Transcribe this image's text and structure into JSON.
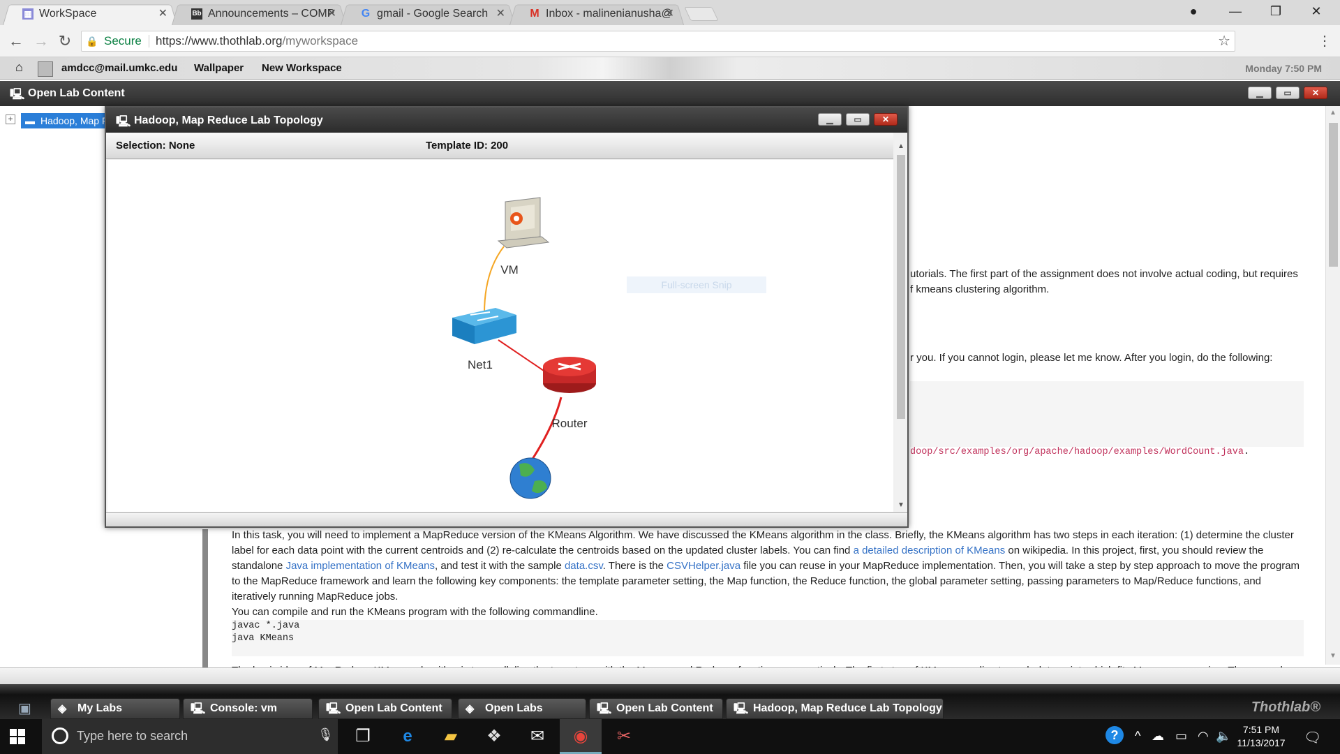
{
  "browser": {
    "tabs": [
      {
        "label": "WorkSpace",
        "icon": "workspace-icon",
        "active": true
      },
      {
        "label": "Announcements – COMP",
        "icon": "bb-icon"
      },
      {
        "label": "gmail - Google Search",
        "icon": "google-icon"
      },
      {
        "label": "Inbox - malinenianusha@",
        "icon": "gmail-icon"
      }
    ],
    "secure_label": "Secure",
    "url_host": "https://www.thothlab.org",
    "url_path": "/myworkspace"
  },
  "labbar": {
    "user": "amdcc@mail.umkc.edu",
    "wallpaper": "Wallpaper",
    "new_workspace": "New Workspace",
    "clock": "Monday 7:50 PM"
  },
  "olc": {
    "title": "Open Lab Content",
    "tree_node": "Hadoop, Map R"
  },
  "doc": {
    "line1": "utorials. The first part of the assignment does not involve actual coding, but requires",
    "line2": "f kmeans clustering algorithm.",
    "line3": "r you. If you cannot login, please let me know. After you login, do the following:",
    "code_path": "doop/src/examples/org/apache/hadoop/examples/WordCount.java",
    "code_path_end": ".",
    "para_a": "In this task, you will need to implement a MapReduce version of the KMeans Algorithm. We have discussed the KMeans algorithm in the class. Briefly, the KMeans algorithm has two steps in each iteration: (1) determine the cluster",
    "para_b": "label for each data point with the current centroids and (2) re-calculate the centroids based on the updated cluster labels. You can find ",
    "link_desc": "a detailed description of KMeans",
    "para_c": " on wikipedia. In this project, first, you should review the",
    "para_d": "standalone ",
    "link_java": "Java implementation of KMeans",
    "para_e": ", and test it with the sample ",
    "link_csv": "data.csv",
    "para_f": ". There is the ",
    "link_helper": "CSVHelper.java",
    "para_g": " file you can reuse in your MapReduce implementation. Then, you will take a step by step approach to move the program",
    "para_h": "to the MapReduce framework and learn the following key components: the template parameter setting, the Map function, the Reduce function, the global parameter setting, passing parameters to Map/Reduce functions, and",
    "para_i": "iteratively running MapReduce jobs.",
    "para_j": "You can compile and run the KMeans program with the following commandline.",
    "code1": "javac *.java",
    "code2": "java KMeans",
    "cut_line": "The basic idea of MapReduce KMeans algorithm is to parallelize the two steps with the Mapper and Reducer functions, respectively. The first step of KMeans applies to each data point, which fits Mapper processing. The second"
  },
  "topology": {
    "title": "Hadoop, Map Reduce Lab Topology",
    "selection": "Selection: None",
    "template_id": "Template ID: 200",
    "devices": [
      {
        "label": "VM",
        "icon": "vm-computer-icon"
      },
      {
        "label": "Net1",
        "icon": "network-switch-icon"
      },
      {
        "label": "Router",
        "icon": "router-icon"
      },
      {
        "label": "",
        "icon": "internet-globe-icon"
      }
    ],
    "snip_text": "Full-screen Snip",
    "colors": {
      "link_vm": "#f5a623",
      "link_red": "#e02020"
    }
  },
  "labtaskbar": {
    "items": [
      {
        "label": "My Labs",
        "icon": "my-labs-icon"
      },
      {
        "label": "Console: vm",
        "icon": "console-icon"
      },
      {
        "label": "Open Lab Content",
        "icon": "window-icon"
      },
      {
        "label": "Open Labs",
        "icon": "open-labs-icon"
      },
      {
        "label": "Open Lab Content",
        "icon": "window-icon"
      },
      {
        "label": "Hadoop, Map Reduce Lab Topology",
        "icon": "window-icon"
      }
    ],
    "brand": "Thothlab®"
  },
  "taskbar": {
    "search_placeholder": "Type here to search",
    "time": "7:51 PM",
    "date": "11/13/2017"
  }
}
